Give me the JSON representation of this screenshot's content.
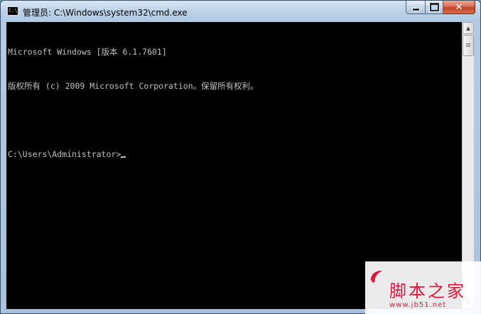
{
  "window": {
    "title": "管理员: C:\\Windows\\system32\\cmd.exe",
    "icon_label": "C:\\",
    "controls": {
      "minimize": "minimize-icon",
      "maximize": "maximize-icon",
      "close": "✕"
    }
  },
  "console": {
    "lines": [
      "Microsoft Windows [版本 6.1.7601]",
      "版权所有 (c) 2009 Microsoft Corporation。保留所有权利。",
      "",
      "C:\\Users\\Administrator>"
    ],
    "text_color": "#c0c0c0",
    "background_color": "#000000"
  },
  "scrollbar": {
    "up_arrow": "▲",
    "down_arrow": "▼"
  },
  "watermark": {
    "title": "脚本之家",
    "url": "www.jb51.net"
  }
}
